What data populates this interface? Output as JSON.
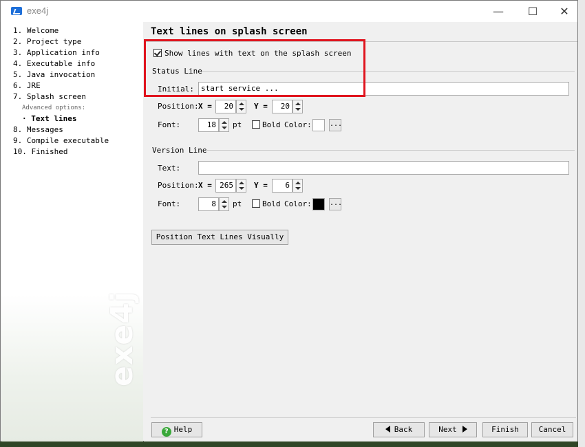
{
  "window": {
    "title": "exe4j"
  },
  "sidebar": {
    "steps": [
      "1. Welcome",
      "2. Project type",
      "3. Application info",
      "4. Executable info",
      "5. Java invocation",
      "6. JRE",
      "7. Splash screen"
    ],
    "advanced_label": "Advanced options:",
    "current_step": "· Text lines",
    "steps_after": [
      "8. Messages",
      "9. Compile executable",
      "10. Finished"
    ],
    "watermark": "exe4j"
  },
  "main": {
    "title": "Text lines on splash screen",
    "show_lines_label": "Show lines with text on the splash screen",
    "show_lines_checked": true,
    "status_line": {
      "group": "Status Line",
      "initial_label": "Initial:",
      "initial_value": "start service ...",
      "position_label": "Position:",
      "x_label": "X =",
      "x_value": "20",
      "y_label": "Y =",
      "y_value": "20",
      "font_label": "Font:",
      "font_size": "18",
      "pt_label": "pt",
      "bold_label": "Bold",
      "color_label": "Color:",
      "color": "#ffffff",
      "more": "..."
    },
    "version_line": {
      "group": "Version Line",
      "text_label": "Text:",
      "text_value": "",
      "position_label": "Position:",
      "x_label": "X =",
      "x_value": "265",
      "y_label": "Y =",
      "y_value": "6",
      "font_label": "Font:",
      "font_size": "8",
      "pt_label": "pt",
      "bold_label": "Bold",
      "color_label": "Color:",
      "color": "#000000",
      "more": "..."
    },
    "position_button": "Position Text Lines Visually"
  },
  "footer": {
    "help": "Help",
    "back": "Back",
    "next": "Next",
    "finish": "Finish",
    "cancel": "Cancel"
  },
  "highlight_color": "#e0141e"
}
